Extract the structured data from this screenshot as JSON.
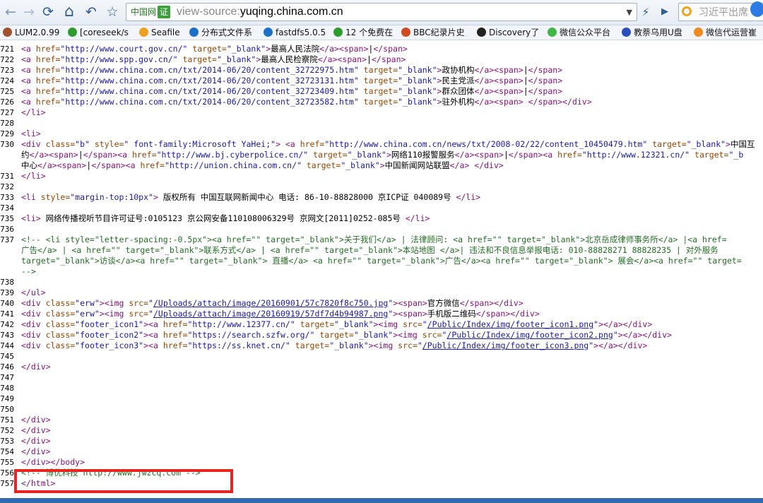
{
  "toolbar": {
    "back": "←",
    "forward": "→",
    "refresh": "⟳",
    "home": "⌂",
    "undo": "↶",
    "favorite": "☆",
    "site_badge": "中国网",
    "cert_badge": "证",
    "url_prefix": "view-source:",
    "url_host": "yuqing.china.com.cn",
    "dropdown": "▼",
    "speed": "⚡",
    "forward2": "▶",
    "search_text": "习近平出席"
  },
  "bookmarks": [
    {
      "label": "LUM2.0.99",
      "icon": "bookmark-icon",
      "color": "#a0522d"
    },
    {
      "label": "[coreseek/s",
      "icon": "c-icon",
      "color": "#2e9b2e"
    },
    {
      "label": "Seafile",
      "icon": "folder-icon",
      "color": "#f0a020"
    },
    {
      "label": "分布式文件系",
      "icon": "u-icon",
      "color": "#1d6fc8"
    },
    {
      "label": "fastdfs5.0.5",
      "icon": "u-icon",
      "color": "#1d6fc8"
    },
    {
      "label": "12 个免费在",
      "icon": "c-icon",
      "color": "#2e9b2e"
    },
    {
      "label": "BBC纪录片史",
      "icon": "cloud-icon",
      "color": "#d14b1e"
    },
    {
      "label": "Discovery了",
      "icon": "discovery-icon",
      "color": "#222222"
    },
    {
      "label": "微信公众平台",
      "icon": "wechat-icon",
      "color": "#44b549"
    },
    {
      "label": "教萘乌用U盘",
      "icon": "paw-icon",
      "color": "#2850b8"
    },
    {
      "label": "微信代运营崔",
      "icon": "orange-icon",
      "color": "#f08a1e"
    }
  ],
  "source_lines": [
    {
      "n": "721",
      "segs": [
        [
          "tag",
          "<a "
        ],
        [
          "attr",
          "href="
        ],
        [
          "val",
          "\"http://www.court.gov.cn/\""
        ],
        [
          "attr",
          " target="
        ],
        [
          "val",
          "\"_blank\""
        ],
        [
          "tag",
          ">"
        ],
        [
          "txt",
          "最高人民法院"
        ],
        [
          "tag",
          "</a><span>"
        ],
        [
          "txt",
          "|"
        ],
        [
          "tag",
          "</span>"
        ]
      ]
    },
    {
      "n": "722",
      "segs": [
        [
          "tag",
          "<a "
        ],
        [
          "attr",
          "href="
        ],
        [
          "val",
          "\"http://www.spp.gov.cn/\""
        ],
        [
          "attr",
          " target="
        ],
        [
          "val",
          "\"_blank\""
        ],
        [
          "tag",
          ">"
        ],
        [
          "txt",
          "最高人民检察院"
        ],
        [
          "tag",
          "</a><span>"
        ],
        [
          "txt",
          "|"
        ],
        [
          "tag",
          "</span>"
        ]
      ]
    },
    {
      "n": "723",
      "segs": [
        [
          "tag",
          "<a "
        ],
        [
          "attr",
          "href="
        ],
        [
          "val",
          "\"http://www.china.com.cn/txt/2014-06/20/content_32722975.htm\""
        ],
        [
          "attr",
          " target="
        ],
        [
          "val",
          "\"_blank\""
        ],
        [
          "tag",
          ">"
        ],
        [
          "txt",
          "政协机构"
        ],
        [
          "tag",
          "</a><span>"
        ],
        [
          "txt",
          "|"
        ],
        [
          "tag",
          "</span>"
        ]
      ]
    },
    {
      "n": "724",
      "segs": [
        [
          "tag",
          "<a "
        ],
        [
          "attr",
          "href="
        ],
        [
          "val",
          "\"http://www.china.com.cn/txt/2014-06/20/content_32723131.htm\""
        ],
        [
          "attr",
          " target="
        ],
        [
          "val",
          "\"_blank\""
        ],
        [
          "tag",
          ">"
        ],
        [
          "txt",
          "民主党派"
        ],
        [
          "tag",
          "</a><span>"
        ],
        [
          "txt",
          "|"
        ],
        [
          "tag",
          "</span>"
        ]
      ]
    },
    {
      "n": "725",
      "segs": [
        [
          "tag",
          "<a "
        ],
        [
          "attr",
          "href="
        ],
        [
          "val",
          "\"http://www.china.com.cn/txt/2014-06/20/content_32723409.htm\""
        ],
        [
          "attr",
          " target="
        ],
        [
          "val",
          "\"_blank\""
        ],
        [
          "tag",
          ">"
        ],
        [
          "txt",
          "群众团体"
        ],
        [
          "tag",
          "</a><span>"
        ],
        [
          "txt",
          "|"
        ],
        [
          "tag",
          "</span>"
        ]
      ]
    },
    {
      "n": "726",
      "segs": [
        [
          "tag",
          "<a "
        ],
        [
          "attr",
          "href="
        ],
        [
          "val",
          "\"http://www.china.com.cn/txt/2014-06/20/content_32723582.htm\""
        ],
        [
          "attr",
          " target="
        ],
        [
          "val",
          "\"_blank\""
        ],
        [
          "tag",
          ">"
        ],
        [
          "txt",
          "驻外机构"
        ],
        [
          "tag",
          "</a><span> </span></div>"
        ]
      ]
    },
    {
      "n": "727",
      "segs": [
        [
          "tag",
          "</li>"
        ]
      ]
    },
    {
      "n": "728",
      "segs": []
    },
    {
      "n": "729",
      "segs": [
        [
          "tag",
          "<li>"
        ]
      ]
    },
    {
      "n": "730",
      "segs": [
        [
          "tag",
          "<div "
        ],
        [
          "attr",
          "class="
        ],
        [
          "val",
          "\"b\""
        ],
        [
          "attr",
          " style="
        ],
        [
          "val",
          "\" font-family:Microsoft YaHei;\""
        ],
        [
          "tag",
          "> <a "
        ],
        [
          "attr",
          "href="
        ],
        [
          "val",
          "\"http://www.china.com.cn/news/txt/2008-02/22/content_10450479.htm\""
        ],
        [
          "attr",
          " target="
        ],
        [
          "val",
          "\"_blank\""
        ],
        [
          "tag",
          ">"
        ],
        [
          "txt",
          "中国互"
        ]
      ]
    },
    {
      "n": "",
      "segs": [
        [
          "txt",
          "约"
        ],
        [
          "tag",
          "</a><span>"
        ],
        [
          "txt",
          "|"
        ],
        [
          "tag",
          "</span><a "
        ],
        [
          "attr",
          "href="
        ],
        [
          "val",
          "\"http://www.bj.cyberpolice.cn/\""
        ],
        [
          "attr",
          " target="
        ],
        [
          "val",
          "\"_blank\""
        ],
        [
          "tag",
          ">"
        ],
        [
          "txt",
          "网络110报警服务"
        ],
        [
          "tag",
          "</a><span>"
        ],
        [
          "txt",
          "|"
        ],
        [
          "tag",
          "</span><a "
        ],
        [
          "attr",
          "href="
        ],
        [
          "val",
          "\"http://www.12321.cn/\""
        ],
        [
          "attr",
          " target="
        ],
        [
          "val",
          "\"_b"
        ]
      ]
    },
    {
      "n": "",
      "segs": [
        [
          "txt",
          "中心"
        ],
        [
          "tag",
          "</a><span>"
        ],
        [
          "txt",
          "|"
        ],
        [
          "tag",
          "</span><a "
        ],
        [
          "attr",
          "href="
        ],
        [
          "val",
          "\"http://union.china.com.cn/\""
        ],
        [
          "attr",
          " target="
        ],
        [
          "val",
          "\"_blank\""
        ],
        [
          "tag",
          ">"
        ],
        [
          "txt",
          "中国新闻网站联盟"
        ],
        [
          "tag",
          "</a> </div>"
        ]
      ]
    },
    {
      "n": "731",
      "segs": [
        [
          "tag",
          "</li>"
        ]
      ]
    },
    {
      "n": "732",
      "segs": []
    },
    {
      "n": "733",
      "segs": [
        [
          "tag",
          "<li "
        ],
        [
          "attr",
          "style="
        ],
        [
          "val",
          "\"margin-top:10px\""
        ],
        [
          "tag",
          ">"
        ],
        [
          "txt",
          " 版权所有 中国互联网新闻中心 电话: 86-10-88828000 京ICP证 040089号 "
        ],
        [
          "tag",
          "</li>"
        ]
      ]
    },
    {
      "n": "734",
      "segs": []
    },
    {
      "n": "735",
      "segs": [
        [
          "tag",
          "<li>"
        ],
        [
          "txt",
          " 网络传播视听节目许可证号:0105123 京公网安备110108006329号 京网文[2011]0252-085号 "
        ],
        [
          "tag",
          "</li>"
        ]
      ]
    },
    {
      "n": "736",
      "segs": []
    },
    {
      "n": "737",
      "segs": [
        [
          "cmt",
          "<!-- <li style=\"letter-spacing:-0.5px\"><a href=\"\" target=\"_blank\">关于我们</a> | 法律顾问: <a href=\"\" target=\"_blank\">北京岳成律师事务所</a> |<a href="
        ]
      ]
    },
    {
      "n": "",
      "segs": [
        [
          "cmt",
          "广告</a> | <a href=\"\" target=\"_blank\">联系方式</a> | <a href=\"\" target=\"_blank\">本站地图 </a>| 违法和不良信息举报电话: 010-88828271 88828235 | 对外服务"
        ]
      ]
    },
    {
      "n": "",
      "segs": [
        [
          "cmt",
          "target=\"_blank\">访谈</a><a href=\"\" target=\"_blank\"> 直播</a> <a href=\"\" target=\"_blank\">广告</a><a href=\"\" target=\"_blank\"> 展会</a><a href=\"\" target="
        ]
      ]
    },
    {
      "n": "",
      "segs": [
        [
          "cmt",
          "-->"
        ]
      ]
    },
    {
      "n": "738",
      "segs": []
    },
    {
      "n": "739",
      "segs": [
        [
          "tag",
          "</ul>"
        ]
      ]
    },
    {
      "n": "740",
      "segs": [
        [
          "tag",
          "<div "
        ],
        [
          "attr",
          "class="
        ],
        [
          "val",
          "\"erw\""
        ],
        [
          "tag",
          "><img "
        ],
        [
          "attr",
          "src="
        ],
        [
          "val",
          "\""
        ],
        [
          "lnk",
          "/Uploads/attach/image/20160901/57c7820f8c750.jpg"
        ],
        [
          "val",
          "\""
        ],
        [
          "tag",
          "><span>"
        ],
        [
          "txt",
          "官方微信"
        ],
        [
          "tag",
          "</span></div>"
        ]
      ]
    },
    {
      "n": "741",
      "segs": [
        [
          "tag",
          "<div "
        ],
        [
          "attr",
          "class="
        ],
        [
          "val",
          "\"erw\""
        ],
        [
          "tag",
          "><img "
        ],
        [
          "attr",
          "src="
        ],
        [
          "val",
          "\""
        ],
        [
          "lnk",
          "/Uploads/attach/image/20160919/57df7d4b94987.png"
        ],
        [
          "val",
          "\""
        ],
        [
          "tag",
          "><span>"
        ],
        [
          "txt",
          "手机版二维码"
        ],
        [
          "tag",
          "</span></div>"
        ]
      ]
    },
    {
      "n": "742",
      "segs": [
        [
          "tag",
          "<div "
        ],
        [
          "attr",
          "class="
        ],
        [
          "val",
          "\"footer_icon1\""
        ],
        [
          "tag",
          "><a "
        ],
        [
          "attr",
          "href="
        ],
        [
          "val",
          "\"http://www.12377.cn/\""
        ],
        [
          "attr",
          " target="
        ],
        [
          "val",
          "\"_blank\""
        ],
        [
          "tag",
          "><img "
        ],
        [
          "attr",
          "src="
        ],
        [
          "val",
          "\""
        ],
        [
          "lnk",
          "/Public/Index/img/footer_icon1.png"
        ],
        [
          "val",
          "\""
        ],
        [
          "tag",
          "></a></div>"
        ]
      ]
    },
    {
      "n": "743",
      "segs": [
        [
          "tag",
          "<div "
        ],
        [
          "attr",
          "class="
        ],
        [
          "val",
          "\"footer_icon2\""
        ],
        [
          "tag",
          "><a "
        ],
        [
          "attr",
          "href="
        ],
        [
          "val",
          "\"https://search.szfw.org/\""
        ],
        [
          "attr",
          " target="
        ],
        [
          "val",
          "\"_blank\""
        ],
        [
          "tag",
          "><img "
        ],
        [
          "attr",
          "src="
        ],
        [
          "val",
          "\""
        ],
        [
          "lnk",
          "/Public/Index/img/footer_icon2.png"
        ],
        [
          "val",
          "\""
        ],
        [
          "tag",
          "></a></div>"
        ]
      ]
    },
    {
      "n": "744",
      "segs": [
        [
          "tag",
          "<div "
        ],
        [
          "attr",
          "class="
        ],
        [
          "val",
          "\"footer_icon3\""
        ],
        [
          "tag",
          "><a "
        ],
        [
          "attr",
          "href="
        ],
        [
          "val",
          "\"https://ss.knet.cn/\""
        ],
        [
          "attr",
          " target="
        ],
        [
          "val",
          "\"_blank\""
        ],
        [
          "tag",
          "><img "
        ],
        [
          "attr",
          "src="
        ],
        [
          "val",
          "\""
        ],
        [
          "lnk",
          "/Public/Index/img/footer_icon3.png"
        ],
        [
          "val",
          "\""
        ],
        [
          "tag",
          "></a></div>"
        ]
      ]
    },
    {
      "n": "745",
      "segs": []
    },
    {
      "n": "746",
      "segs": [
        [
          "tag",
          "</div>"
        ]
      ]
    },
    {
      "n": "747",
      "segs": []
    },
    {
      "n": "748",
      "segs": []
    },
    {
      "n": "749",
      "segs": []
    },
    {
      "n": "750",
      "segs": []
    },
    {
      "n": "751",
      "segs": [
        [
          "tag",
          "</div>"
        ]
      ]
    },
    {
      "n": "752",
      "segs": [
        [
          "tag",
          "</div>"
        ]
      ]
    },
    {
      "n": "753",
      "segs": [
        [
          "tag",
          "</div>"
        ]
      ]
    },
    {
      "n": "754",
      "segs": [
        [
          "tag",
          "</div>"
        ]
      ]
    },
    {
      "n": "755",
      "segs": [
        [
          "tag",
          "</div></body>"
        ]
      ]
    },
    {
      "n": "756",
      "segs": [
        [
          "cmt",
          "<!-- 博优科技 http://www.jwzcq.com -->"
        ]
      ]
    },
    {
      "n": "757",
      "segs": [
        [
          "tag",
          "</html>"
        ]
      ]
    }
  ],
  "colors": {
    "highlight": "#e8251f",
    "tag": "#881280",
    "attr": "#994500",
    "value": "#1a1aa6",
    "comment": "#236e25"
  }
}
